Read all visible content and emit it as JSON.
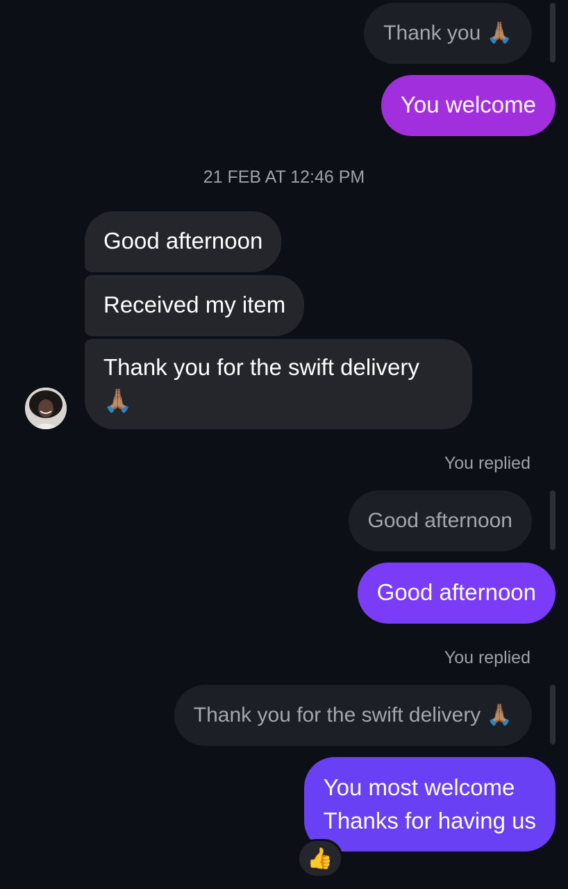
{
  "conversation": {
    "top_reply": {
      "quoted_text": "Thank you 🙏🏽",
      "outgoing_text": "You welcome"
    },
    "timestamp": "21 FEB AT 12:46 PM",
    "incoming": [
      {
        "text": "Good afternoon"
      },
      {
        "text": "Received my item"
      },
      {
        "text": "Thank you for the swift delivery 🙏🏽"
      }
    ],
    "reply_1": {
      "label": "You replied",
      "quoted_text": "Good afternoon",
      "outgoing_text": "Good afternoon"
    },
    "reply_2": {
      "label": "You replied",
      "quoted_text": "Thank you for the swift delivery 🙏🏽",
      "outgoing_line1": "You most welcome",
      "outgoing_line2": "Thanks for having us",
      "reaction": "👍"
    }
  },
  "colors": {
    "background": "#0c0f16",
    "incoming_bubble": "#24262c",
    "quoted_bubble": "#1c1f26",
    "outgoing_gradient": [
      "#a12fde",
      "#7a3cf6",
      "#6a40f4"
    ]
  },
  "icons": {
    "avatar": "contact-avatar",
    "reaction": "thumbs-up"
  }
}
